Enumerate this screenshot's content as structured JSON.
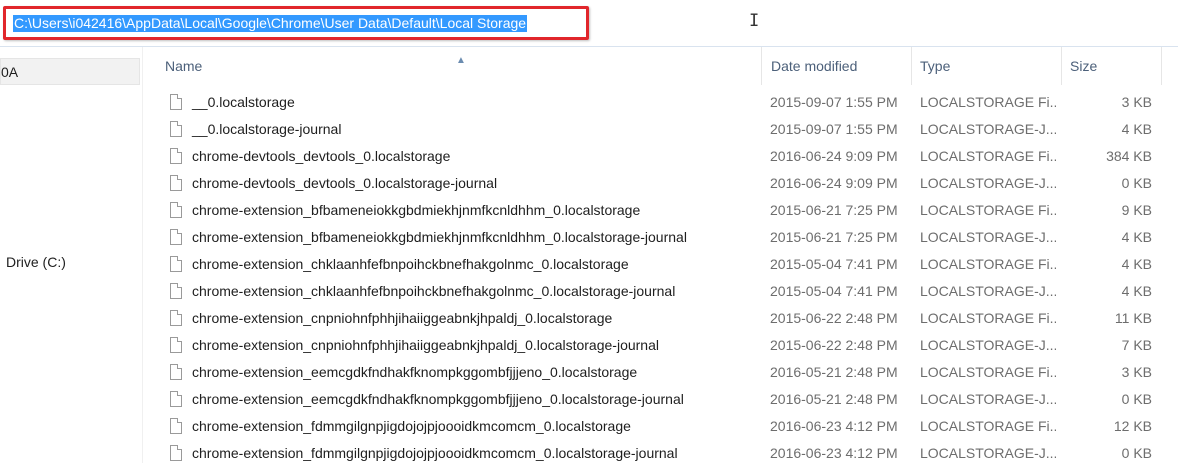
{
  "address_bar": {
    "path": "C:\\Users\\i042416\\AppData\\Local\\Google\\Chrome\\User Data\\Default\\Local Storage",
    "highlight_color": "#e1262b",
    "selection_color": "#3399ff"
  },
  "nav": {
    "items": [
      {
        "label": "0A",
        "selected": true
      },
      {
        "label": "Drive (C:)"
      }
    ]
  },
  "columns": {
    "name": "Name",
    "date": "Date modified",
    "type": "Type",
    "size": "Size",
    "sorted_by": "Name"
  },
  "files": [
    {
      "name": "__0.localstorage",
      "date": "2015-09-07 1:55 PM",
      "type": "LOCALSTORAGE Fi...",
      "size": "3 KB"
    },
    {
      "name": "__0.localstorage-journal",
      "date": "2015-09-07 1:55 PM",
      "type": "LOCALSTORAGE-J...",
      "size": "4 KB"
    },
    {
      "name": "chrome-devtools_devtools_0.localstorage",
      "date": "2016-06-24 9:09 PM",
      "type": "LOCALSTORAGE Fi...",
      "size": "384 KB"
    },
    {
      "name": "chrome-devtools_devtools_0.localstorage-journal",
      "date": "2016-06-24 9:09 PM",
      "type": "LOCALSTORAGE-J...",
      "size": "0 KB"
    },
    {
      "name": "chrome-extension_bfbameneiokkgbdmiekhjnmfkcnldhhm_0.localstorage",
      "date": "2015-06-21 7:25 PM",
      "type": "LOCALSTORAGE Fi...",
      "size": "9 KB"
    },
    {
      "name": "chrome-extension_bfbameneiokkgbdmiekhjnmfkcnldhhm_0.localstorage-journal",
      "date": "2015-06-21 7:25 PM",
      "type": "LOCALSTORAGE-J...",
      "size": "4 KB"
    },
    {
      "name": "chrome-extension_chklaanhfefbnpoihckbnefhakgolnmc_0.localstorage",
      "date": "2015-05-04 7:41 PM",
      "type": "LOCALSTORAGE Fi...",
      "size": "4 KB"
    },
    {
      "name": "chrome-extension_chklaanhfefbnpoihckbnefhakgolnmc_0.localstorage-journal",
      "date": "2015-05-04 7:41 PM",
      "type": "LOCALSTORAGE-J...",
      "size": "4 KB"
    },
    {
      "name": "chrome-extension_cnpniohnfphhjihaiiggeabnkjhpaldj_0.localstorage",
      "date": "2015-06-22 2:48 PM",
      "type": "LOCALSTORAGE Fi...",
      "size": "11 KB"
    },
    {
      "name": "chrome-extension_cnpniohnfphhjihaiiggeabnkjhpaldj_0.localstorage-journal",
      "date": "2015-06-22 2:48 PM",
      "type": "LOCALSTORAGE-J...",
      "size": "7 KB"
    },
    {
      "name": "chrome-extension_eemcgdkfndhakfknompkggombfjjjeno_0.localstorage",
      "date": "2016-05-21 2:48 PM",
      "type": "LOCALSTORAGE Fi...",
      "size": "3 KB"
    },
    {
      "name": "chrome-extension_eemcgdkfndhakfknompkggombfjjjeno_0.localstorage-journal",
      "date": "2016-05-21 2:48 PM",
      "type": "LOCALSTORAGE-J...",
      "size": "0 KB"
    },
    {
      "name": "chrome-extension_fdmmgilgnpjigdojojpjoooidkmcomcm_0.localstorage",
      "date": "2016-06-23 4:12 PM",
      "type": "LOCALSTORAGE Fi...",
      "size": "12 KB"
    },
    {
      "name": "chrome-extension_fdmmgilgnpjigdojojpjoooidkmcomcm_0.localstorage-journal",
      "date": "2016-06-23 4:12 PM",
      "type": "LOCALSTORAGE-J...",
      "size": "0 KB"
    }
  ]
}
